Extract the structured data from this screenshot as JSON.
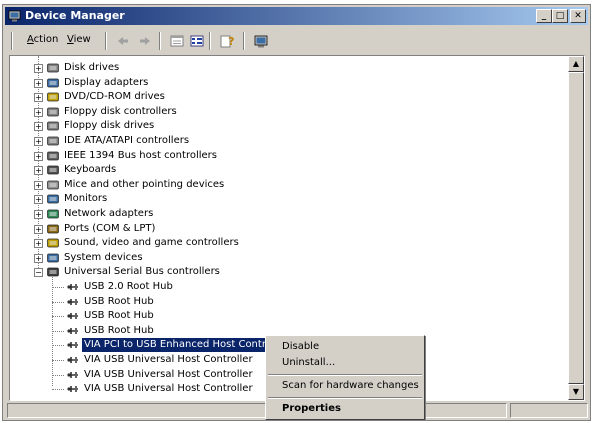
{
  "window": {
    "title": "Device Manager",
    "minimize": "_",
    "maximize": "□",
    "close": "✕"
  },
  "menu": {
    "action_first": "A",
    "action_rest": "ction",
    "view_first": "V",
    "view_rest": "iew"
  },
  "toolbar_icons": [
    "back-arrow-icon",
    "forward-arrow-icon",
    "properties-icon",
    "list-view-icon",
    "help-icon",
    "scan-hardware-icon"
  ],
  "tree": {
    "categories": [
      {
        "label": "Disk drives",
        "icon": "disk-drive-icon"
      },
      {
        "label": "Display adapters",
        "icon": "monitor-icon"
      },
      {
        "label": "DVD/CD-ROM drives",
        "icon": "cdrom-icon"
      },
      {
        "label": "Floppy disk controllers",
        "icon": "floppy-controller-icon"
      },
      {
        "label": "Floppy disk drives",
        "icon": "floppy-drive-icon"
      },
      {
        "label": "IDE ATA/ATAPI controllers",
        "icon": "ide-controller-icon"
      },
      {
        "label": "IEEE 1394 Bus host controllers",
        "icon": "ieee1394-icon"
      },
      {
        "label": "Keyboards",
        "icon": "keyboard-icon"
      },
      {
        "label": "Mice and other pointing devices",
        "icon": "mouse-icon"
      },
      {
        "label": "Monitors",
        "icon": "monitor-icon"
      },
      {
        "label": "Network adapters",
        "icon": "network-icon"
      },
      {
        "label": "Ports (COM & LPT)",
        "icon": "port-icon"
      },
      {
        "label": "Sound, video and game controllers",
        "icon": "sound-icon"
      },
      {
        "label": "System devices",
        "icon": "system-device-icon"
      },
      {
        "label": "Universal Serial Bus controllers",
        "icon": "usb-icon"
      }
    ],
    "usb_children": [
      "USB 2.0 Root Hub",
      "USB Root Hub",
      "USB Root Hub",
      "USB Root Hub",
      "VIA PCI to USB Enhanced Host Controller",
      "VIA USB Universal Host Controller",
      "VIA USB Universal Host Controller",
      "VIA USB Universal Host Controller"
    ],
    "expand_symbol": "+",
    "collapse_symbol": "−"
  },
  "context_menu": {
    "disable": "Disable",
    "uninstall": "Uninstall...",
    "scan": "Scan for hardware changes",
    "properties": "Properties"
  },
  "scrollbar": {
    "up": "▲",
    "down": "▼"
  },
  "colors": {
    "title_start": "#0a246a",
    "title_end": "#a6caf0",
    "selection": "#0a246a",
    "face": "#d4d0c8"
  }
}
